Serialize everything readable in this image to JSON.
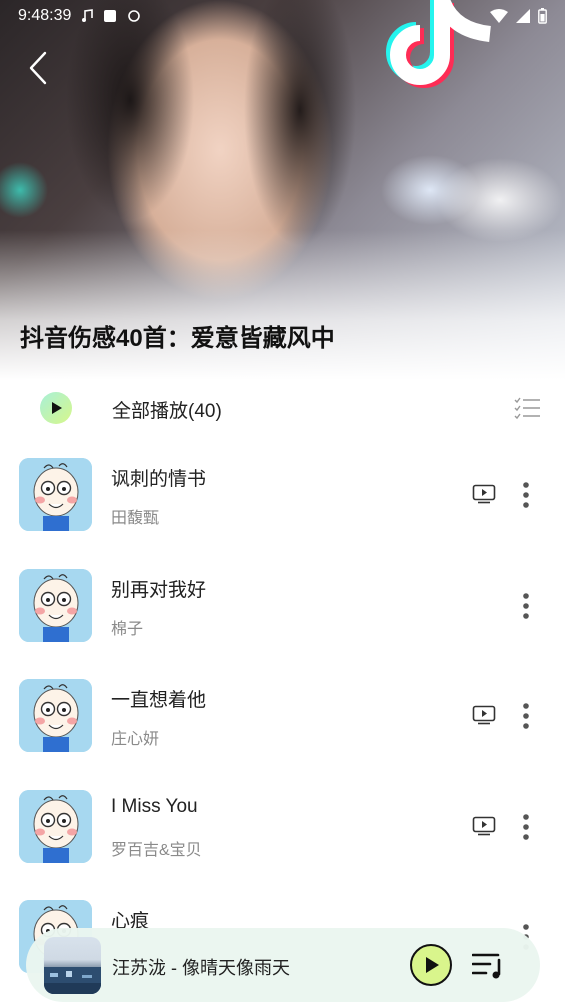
{
  "status_bar": {
    "time": "9:48:39"
  },
  "header": {
    "back_icon": "chevron-left-icon",
    "title": "抖音伤感40首：爱意皆藏风中"
  },
  "play_all": {
    "label": "全部播放(40)",
    "play_icon": "play-icon",
    "multi_select_icon": "checklist-icon"
  },
  "songs": [
    {
      "title": "讽刺的情书",
      "artist": "田馥甄",
      "has_mv": true
    },
    {
      "title": "别再对我好",
      "artist": "棉子",
      "has_mv": false
    },
    {
      "title": "一直想着他",
      "artist": "庄心妍",
      "has_mv": true
    },
    {
      "title": "I Miss You",
      "artist": "罗百吉&宝贝",
      "has_mv": true
    },
    {
      "title": "心痕",
      "artist": "",
      "has_mv": false
    }
  ],
  "mini_player": {
    "now_playing": "汪苏泷 - 像晴天像雨天",
    "play_icon": "play-icon",
    "queue_icon": "playlist-icon"
  },
  "colors": {
    "accent": "#d9f58c",
    "mini_player_bg": "#eaf6f0",
    "secondary_text": "#8a8a8a"
  }
}
